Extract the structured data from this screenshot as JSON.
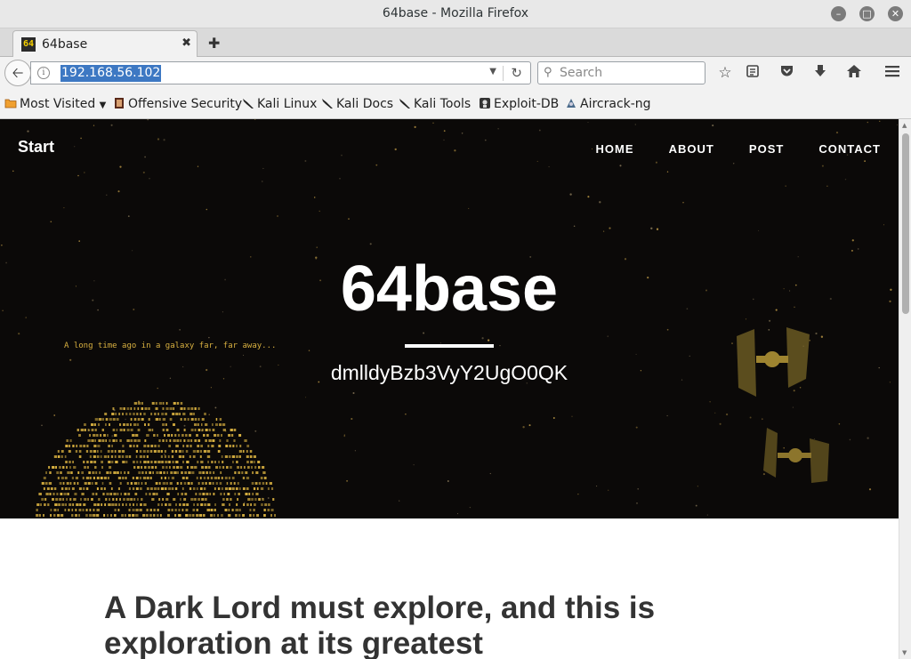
{
  "window": {
    "title": "64base - Mozilla Firefox"
  },
  "tabs": [
    {
      "favicon_text": "64",
      "label": "64base"
    }
  ],
  "navbar": {
    "url": "192.168.56.102",
    "search_placeholder": "Search"
  },
  "icons": {
    "back": "back-arrow-icon",
    "info": "info-icon",
    "reload": "reload-icon",
    "search": "search-icon",
    "bookmark_star": "star-icon",
    "reading_list": "reading-list-icon",
    "pocket": "pocket-icon",
    "downloads": "download-icon",
    "home": "home-icon",
    "menu": "hamburger-menu-icon"
  },
  "bookmarks": [
    {
      "label": "Most Visited",
      "icon": "folder-icon",
      "has_dropdown": true
    },
    {
      "label": "Offensive Security",
      "icon": "offsec-icon"
    },
    {
      "label": "Kali Linux",
      "icon": "kali-dragon-icon"
    },
    {
      "label": "Kali Docs",
      "icon": "kali-dragon-icon"
    },
    {
      "label": "Kali Tools",
      "icon": "kali-dragon-icon"
    },
    {
      "label": "Exploit-DB",
      "icon": "exploitdb-icon"
    },
    {
      "label": "Aircrack-ng",
      "icon": "aircrack-icon"
    }
  ],
  "site": {
    "brand": "Start",
    "nav": [
      "HOME",
      "ABOUT",
      "POST",
      "CONTACT"
    ],
    "hero_title": "64base",
    "hero_subtitle": "dmlldyBzb3VyY2UgO0QK",
    "crawl_text": "A long time ago in a galaxy far, far away...",
    "post_heading": "A Dark Lord must explore, and this is exploration at its greatest"
  },
  "colors": {
    "hero_bg": "#0b0908",
    "ascii_gold": "#d8b040",
    "url_highlight": "#3d78c3"
  }
}
